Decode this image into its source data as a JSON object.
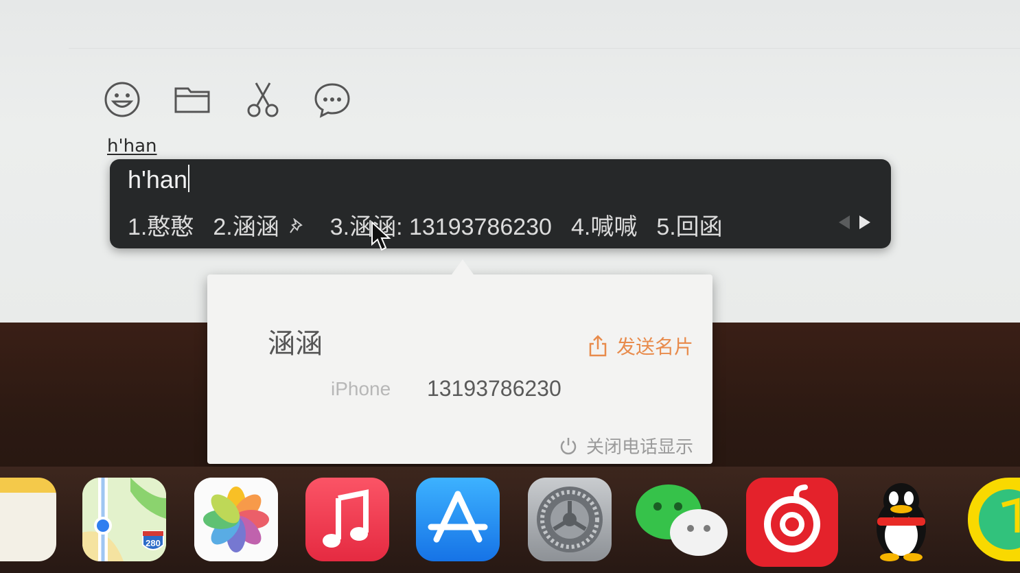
{
  "chat_input": {
    "toolbar": [
      {
        "name": "emoji-icon"
      },
      {
        "name": "folder-icon"
      },
      {
        "name": "scissors-icon"
      },
      {
        "name": "chat-bubble-icon"
      }
    ],
    "composition_text": "h'han"
  },
  "ime": {
    "input": "h'han",
    "candidates": [
      "1.憨憨",
      "2.涵涵",
      "3.涵涵: 13193786230",
      "4.喊喊",
      "5.回函"
    ],
    "pinned_candidate_index": 1
  },
  "contact_card": {
    "name": "涵涵",
    "send_card_label": "发送名片",
    "phone_label": "iPhone",
    "phone_number": "13193786230",
    "close_display_label": "关闭电话显示",
    "accent_color": "#e88b4c"
  },
  "dock": {
    "apps": [
      "notes-icon",
      "maps-icon",
      "photos-icon",
      "music-icon",
      "app-store-icon",
      "system-preferences-icon",
      "wechat-icon",
      "netease-music-icon",
      "qq-icon",
      "qq-music-icon"
    ],
    "maps_badge": "280"
  }
}
